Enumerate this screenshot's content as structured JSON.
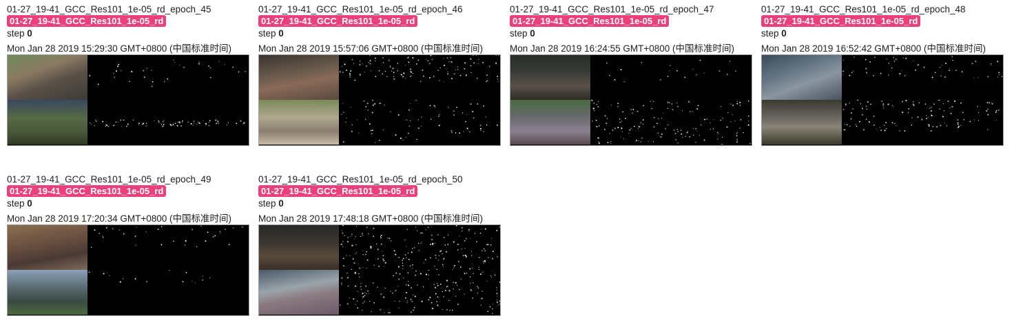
{
  "cards": [
    {
      "tag": "01-27_19-41_GCC_Res101_1e-05_rd_epoch_45",
      "run": "01-27_19-41_GCC_Res101_1e-05_rd",
      "step_label": "step",
      "step_value": "0",
      "date": "Mon Jan 28 2019 15:29:30 GMT+0800 (中国标准时间)"
    },
    {
      "tag": "01-27_19-41_GCC_Res101_1e-05_rd_epoch_46",
      "run": "01-27_19-41_GCC_Res101_1e-05_rd",
      "step_label": "step",
      "step_value": "0",
      "date": "Mon Jan 28 2019 15:57:06 GMT+0800 (中国标准时间)"
    },
    {
      "tag": "01-27_19-41_GCC_Res101_1e-05_rd_epoch_47",
      "run": "01-27_19-41_GCC_Res101_1e-05_rd",
      "step_label": "step",
      "step_value": "0",
      "date": "Mon Jan 28 2019 16:24:55 GMT+0800 (中国标准时间)"
    },
    {
      "tag": "01-27_19-41_GCC_Res101_1e-05_rd_epoch_48",
      "run": "01-27_19-41_GCC_Res101_1e-05_rd",
      "step_label": "step",
      "step_value": "0",
      "date": "Mon Jan 28 2019 16:52:42 GMT+0800 (中国标准时间)"
    },
    {
      "tag": "01-27_19-41_GCC_Res101_1e-05_rd_epoch_49",
      "run": "01-27_19-41_GCC_Res101_1e-05_rd",
      "step_label": "step",
      "step_value": "0",
      "date": "Mon Jan 28 2019 17:20:34 GMT+0800 (中国标准时间)"
    },
    {
      "tag": "01-27_19-41_GCC_Res101_1e-05_rd_epoch_50",
      "run": "01-27_19-41_GCC_Res101_1e-05_rd",
      "step_label": "step",
      "step_value": "0",
      "date": "Mon Jan 28 2019 17:48:18 GMT+0800 (中国标准时间)"
    }
  ],
  "colors": {
    "run_badge": "#ec407a",
    "frame_border": "#9e9e9e"
  }
}
